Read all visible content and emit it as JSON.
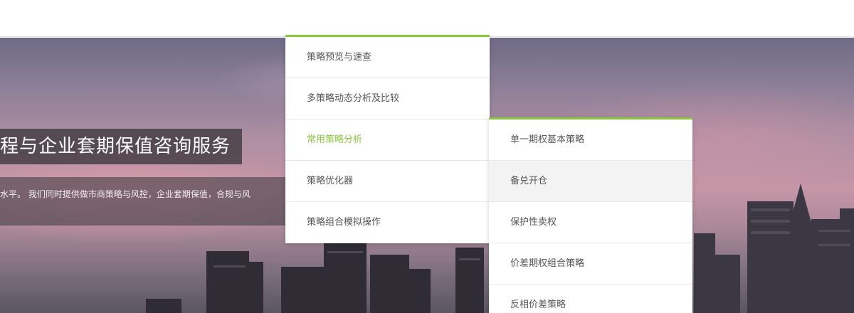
{
  "hero": {
    "title": "程与企业套期保值咨询服务",
    "subtitle": "水平。 我们同时提供做市商策略与风控，企业套期保值，合规与风"
  },
  "menu": {
    "main_items": [
      {
        "label": "策略预览与速查"
      },
      {
        "label": "多策略动态分析及比较"
      },
      {
        "label": "常用策略分析"
      },
      {
        "label": "策略优化器"
      },
      {
        "label": "策略组合模拟操作"
      }
    ],
    "sub_items": [
      {
        "label": "单一期权基本策略"
      },
      {
        "label": "备兑开仓"
      },
      {
        "label": "保护性卖权"
      },
      {
        "label": "价差期权组合策略"
      },
      {
        "label": "反相价差策略"
      }
    ]
  },
  "colors": {
    "accent": "#8cc63f",
    "menu_text": "#555555",
    "hover_bg": "#f3f3f3"
  }
}
